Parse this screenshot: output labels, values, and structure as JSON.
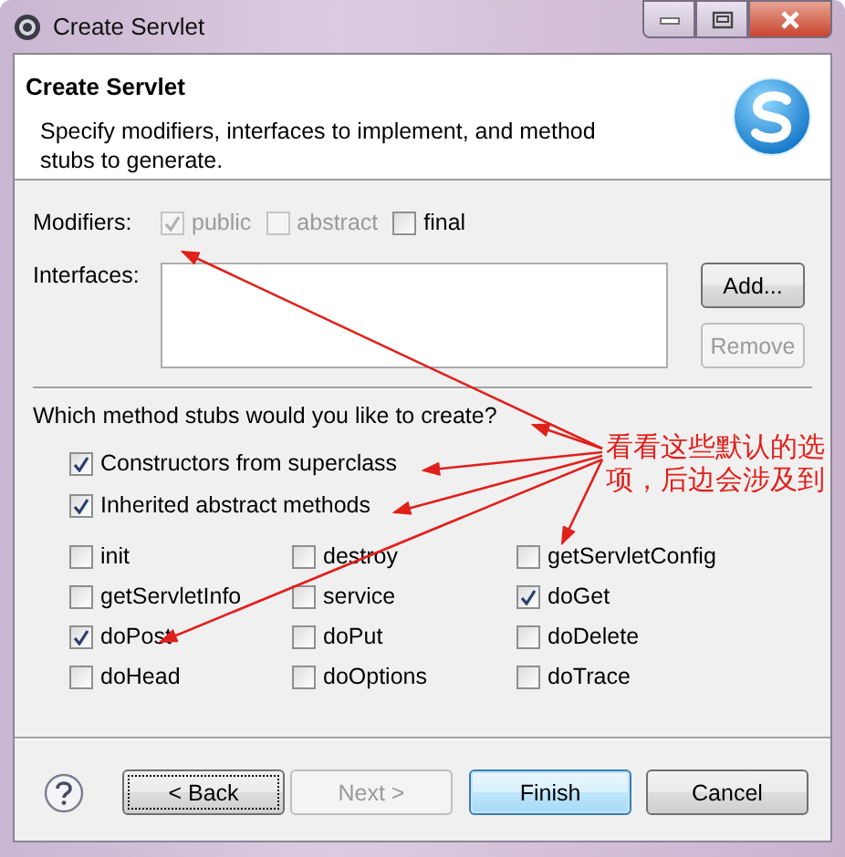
{
  "window": {
    "title": "Create Servlet"
  },
  "header": {
    "title": "Create Servlet",
    "description": "Specify modifiers, interfaces to implement, and method stubs to generate."
  },
  "modifiers": {
    "label": "Modifiers:",
    "options": [
      {
        "label": "public",
        "checked": true,
        "disabled": true
      },
      {
        "label": "abstract",
        "checked": false,
        "disabled": true
      },
      {
        "label": "final",
        "checked": false,
        "disabled": false
      }
    ]
  },
  "interfaces": {
    "label": "Interfaces:",
    "buttons": [
      {
        "label": "Add...",
        "disabled": false
      },
      {
        "label": "Remove",
        "disabled": true
      }
    ]
  },
  "stubs": {
    "question": "Which method stubs would you like to create?",
    "general": [
      {
        "label": "Constructors from superclass",
        "checked": true
      },
      {
        "label": "Inherited abstract methods",
        "checked": true
      }
    ],
    "methods": [
      {
        "label": "init",
        "checked": false
      },
      {
        "label": "destroy",
        "checked": false
      },
      {
        "label": "getServletConfig",
        "checked": false
      },
      {
        "label": "getServletInfo",
        "checked": false
      },
      {
        "label": "service",
        "checked": false
      },
      {
        "label": "doGet",
        "checked": true
      },
      {
        "label": "doPost",
        "checked": true
      },
      {
        "label": "doPut",
        "checked": false
      },
      {
        "label": "doDelete",
        "checked": false
      },
      {
        "label": "doHead",
        "checked": false
      },
      {
        "label": "doOptions",
        "checked": false
      },
      {
        "label": "doTrace",
        "checked": false
      }
    ]
  },
  "annotation": {
    "lines": [
      "看看这些默认的选",
      "项，后边会涉及到"
    ]
  },
  "footer": {
    "buttons": [
      {
        "label": "< Back",
        "disabled": false,
        "default": false,
        "focused": true
      },
      {
        "label": "Next >",
        "disabled": true,
        "default": false,
        "focused": false
      },
      {
        "label": "Finish",
        "disabled": false,
        "default": true,
        "focused": false
      },
      {
        "label": "Cancel",
        "disabled": false,
        "default": false,
        "focused": false
      }
    ]
  }
}
